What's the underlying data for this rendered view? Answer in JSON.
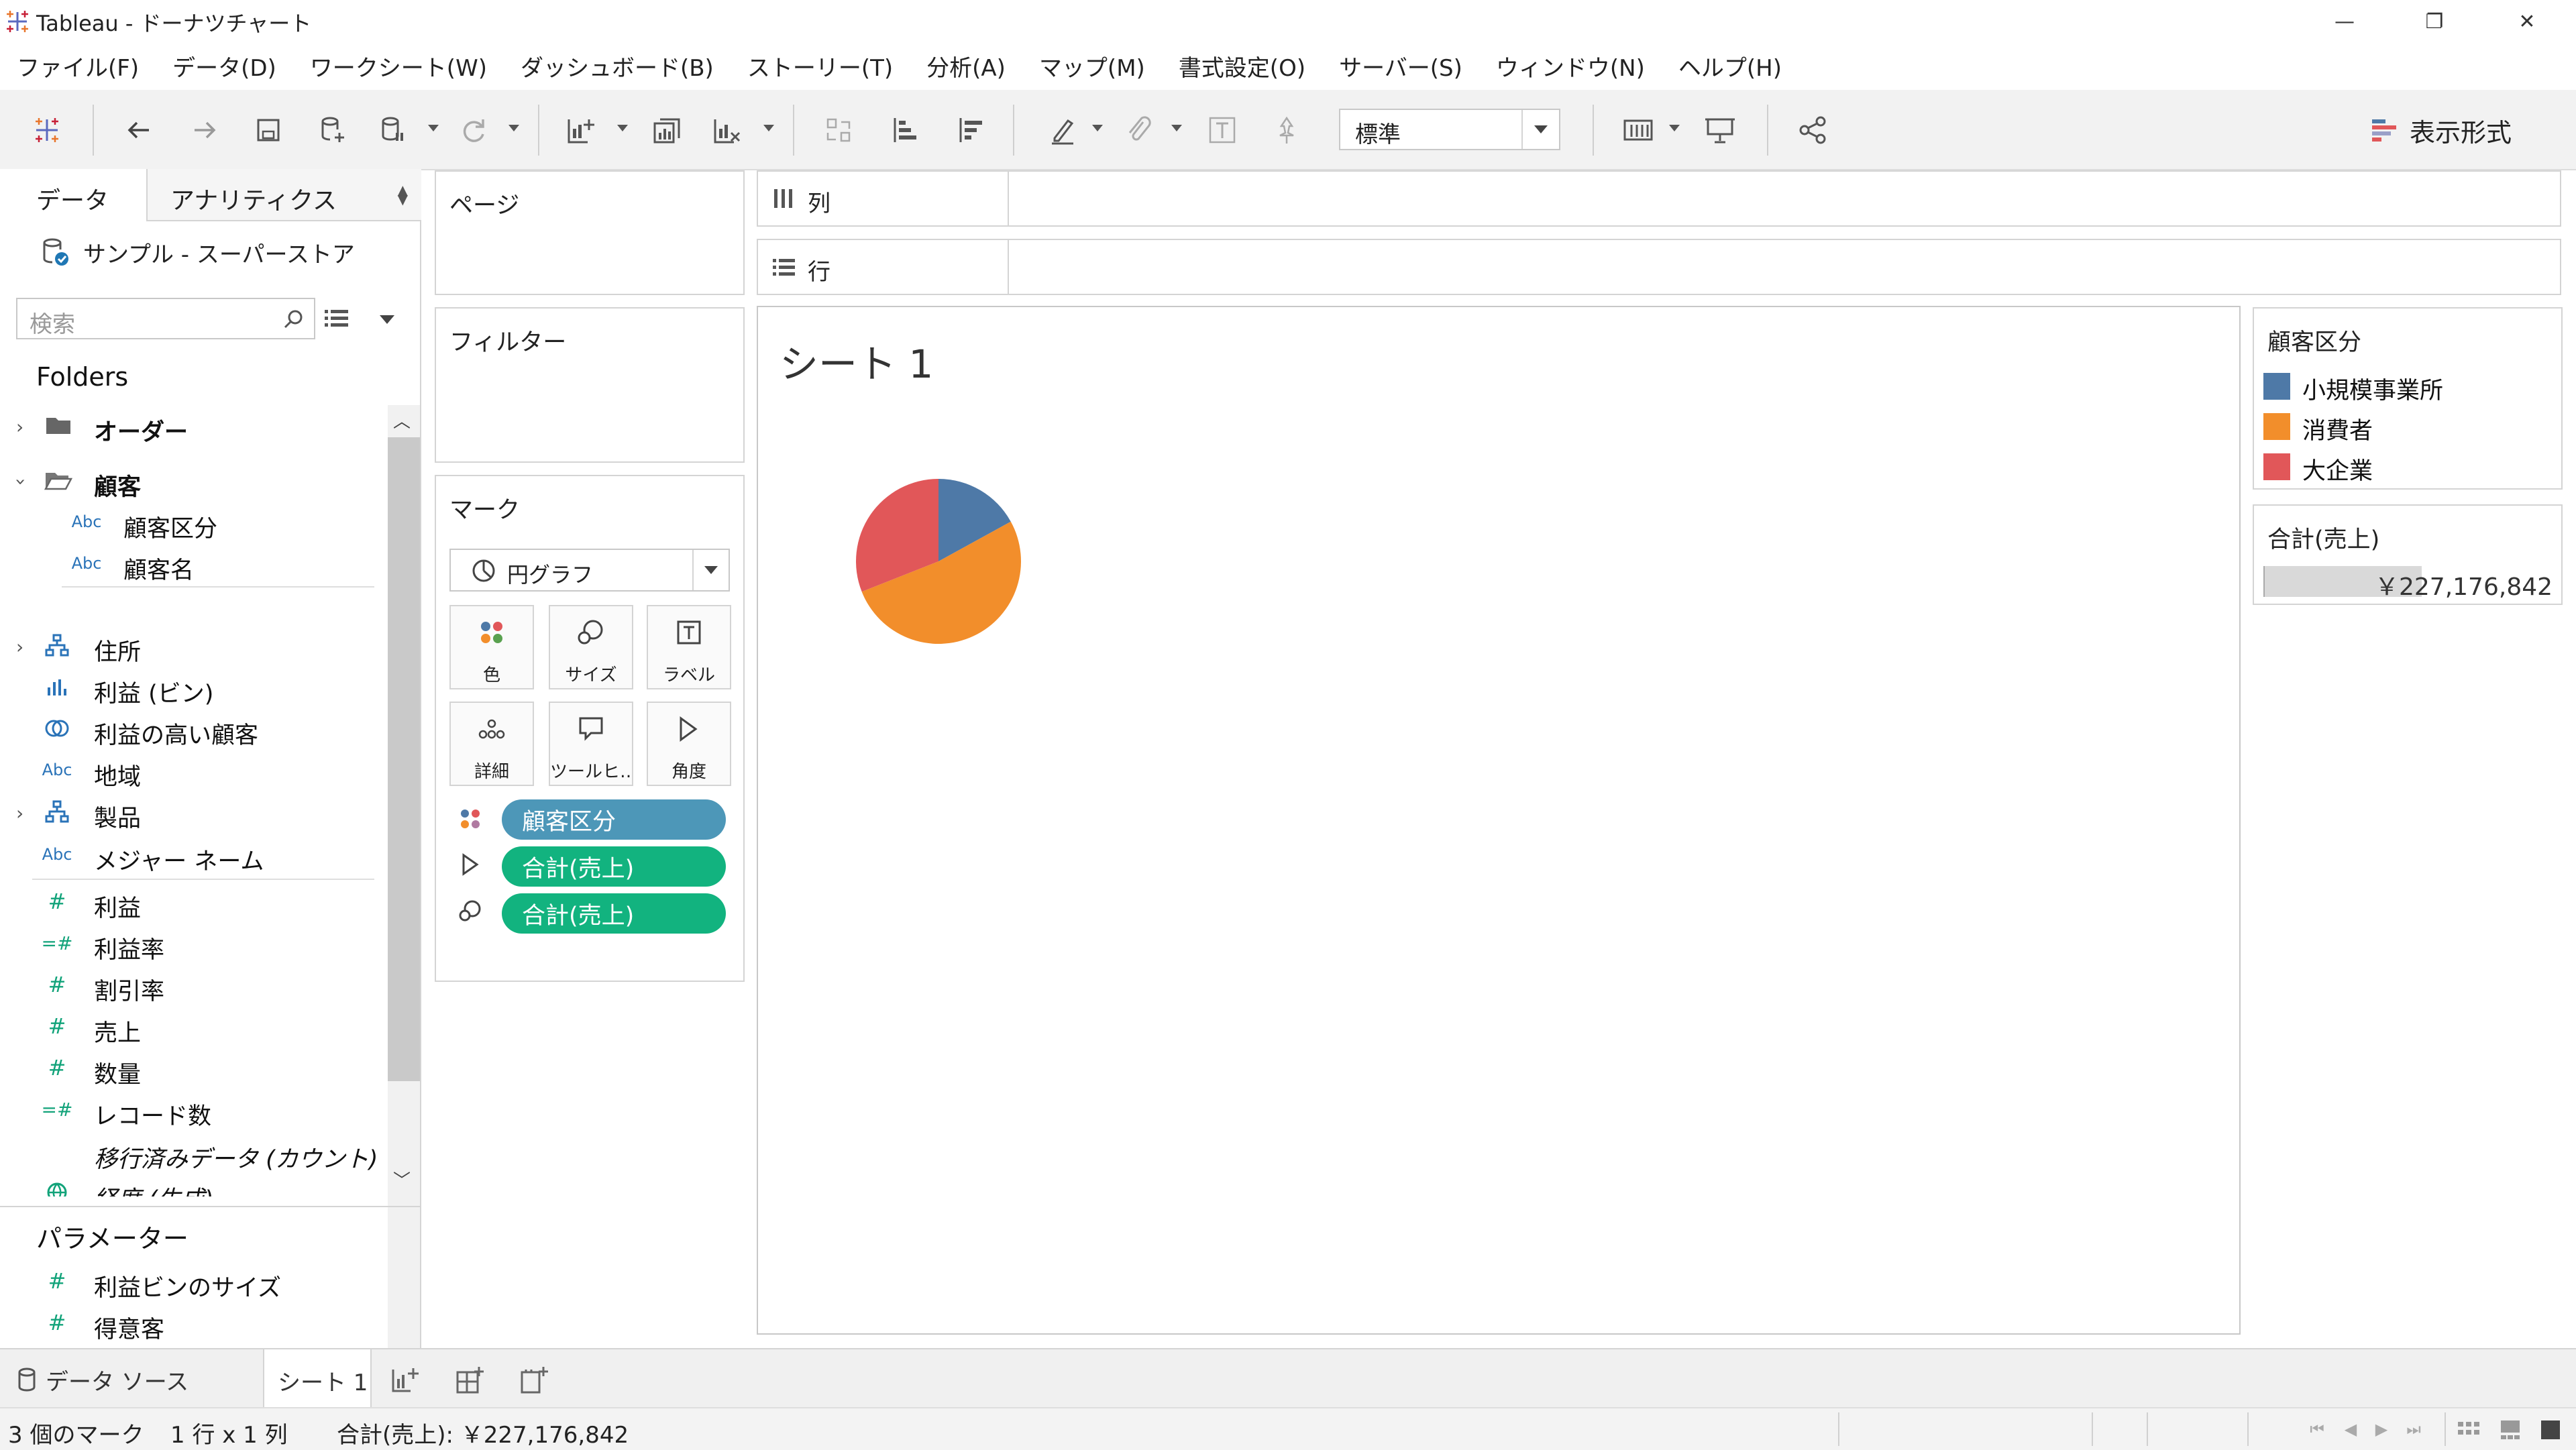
{
  "window": {
    "title": "Tableau - ドーナツチャート",
    "minimize": "—",
    "restore": "❐",
    "close": "✕"
  },
  "menu": [
    "ファイル(F)",
    "データ(D)",
    "ワークシート(W)",
    "ダッシュボード(B)",
    "ストーリー(T)",
    "分析(A)",
    "マップ(M)",
    "書式設定(O)",
    "サーバー(S)",
    "ウィンドウ(N)",
    "ヘルプ(H)"
  ],
  "toolbar": {
    "fit_value": "標準",
    "show_me_label": "表示形式"
  },
  "data_pane": {
    "tab_data": "データ",
    "tab_analytics": "アナリティクス",
    "datasource": "サンプル - スーパーストア",
    "search_placeholder": "検索",
    "folders_title": "Folders",
    "fields": [
      {
        "label": "オーダー",
        "bold": true
      },
      {
        "label": "顧客",
        "bold": true
      },
      {
        "label": "顧客区分",
        "type": "Abc"
      },
      {
        "label": "顧客名",
        "type": "Abc"
      },
      {
        "label": "住所"
      },
      {
        "label": "利益 (ビン)"
      },
      {
        "label": "利益の高い顧客"
      },
      {
        "label": "地域",
        "type": "Abc"
      },
      {
        "label": "製品"
      },
      {
        "label": "メジャー ネーム",
        "type": "Abc"
      },
      {
        "label": "利益",
        "type": "#"
      },
      {
        "label": "利益率",
        "type": "=#"
      },
      {
        "label": "割引率",
        "type": "#"
      },
      {
        "label": "売上",
        "type": "#"
      },
      {
        "label": "数量",
        "type": "#"
      },
      {
        "label": "レコード数",
        "type": "=#"
      },
      {
        "label": "移行済みデータ (カウント)"
      },
      {
        "label": "経度 (生成)"
      }
    ],
    "params_title": "パラメーター",
    "params": [
      {
        "label": "利益ビンのサイズ",
        "type": "#"
      },
      {
        "label": "得意客",
        "type": "#"
      }
    ]
  },
  "cards": {
    "pages": "ページ",
    "filters": "フィルター",
    "marks": "マーク",
    "mark_type": "円グラフ",
    "buttons": [
      "色",
      "サイズ",
      "ラベル",
      "詳細",
      "ツールヒ…",
      "角度"
    ],
    "pills": [
      {
        "label": "顧客区分",
        "color": "#4d97b8"
      },
      {
        "label": "合計(売上)",
        "color": "#12b37f"
      },
      {
        "label": "合計(売上)",
        "color": "#12b37f"
      }
    ]
  },
  "shelves": {
    "columns": "列",
    "rows": "行"
  },
  "sheet": {
    "title": "シート 1"
  },
  "chart_data": {
    "type": "pie",
    "categories": [
      "小規模事業所",
      "消費者",
      "大企業"
    ],
    "values": [
      17,
      52,
      31
    ],
    "colors": [
      "#4e79a7",
      "#f28e2b",
      "#e15759"
    ]
  },
  "legend": {
    "title": "顧客区分",
    "items": [
      {
        "label": "小規模事業所",
        "color": "#4e79a7"
      },
      {
        "label": "消費者",
        "color": "#f28e2b"
      },
      {
        "label": "大企業",
        "color": "#e15759"
      }
    ]
  },
  "size_legend": {
    "title": "合計(売上)",
    "value": "￥227,176,842"
  },
  "tabs": {
    "datasource": "データ ソース",
    "sheet1": "シート 1"
  },
  "status": {
    "marks": "3 個のマーク",
    "dims": "1 行 x 1 列",
    "sum": "合計(売上): ￥227,176,842"
  }
}
